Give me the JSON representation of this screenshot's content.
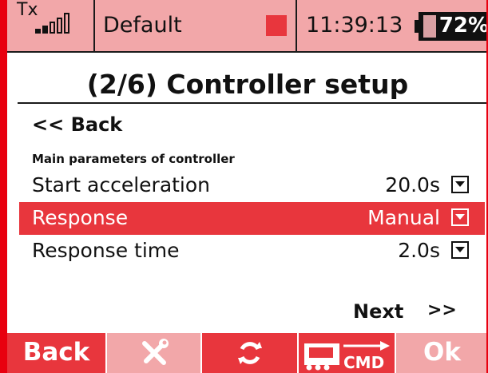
{
  "status_bar": {
    "tx_label": "Tx",
    "model_name": "Default",
    "time": "11:39:13",
    "battery_percent": "72%",
    "battery_level": 0.72,
    "signal_bars_filled": 2,
    "signal_bars_total": 5,
    "record_indicator_color": "#e8363d"
  },
  "page": {
    "title": "(2/6) Controller setup",
    "back_label": "<< Back",
    "section_label": "Main parameters of controller"
  },
  "settings": [
    {
      "label": "Start acceleration",
      "value": "20.0s",
      "selected": false
    },
    {
      "label": "Response",
      "value": "Manual",
      "selected": true
    },
    {
      "label": "Response time",
      "value": "2.0s",
      "selected": false
    }
  ],
  "navigation": {
    "next_label": "Next",
    "next_arrows": ">>"
  },
  "softkeys": {
    "back_label": "Back",
    "tools_icon": "wrench-screwdriver-icon",
    "refresh_icon": "refresh-icon",
    "cmd_icon": "cmd-transfer-icon",
    "cmd_label": "CMD",
    "ok_label": "Ok"
  },
  "colors": {
    "accent_red": "#e8363d",
    "border_red": "#e8000f",
    "light_red": "#f2a7a9"
  }
}
